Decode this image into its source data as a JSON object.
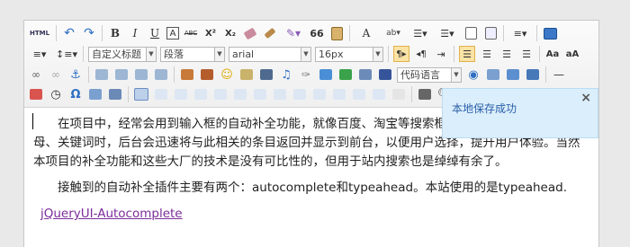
{
  "editor": {
    "toolbar": {
      "html_label": "HTML",
      "bold": "B",
      "italic": "I",
      "underline": "U",
      "fontborder": "A",
      "strikethrough": "ABC",
      "superscript": "X²",
      "subscript": "X₂",
      "blockquote": "66",
      "forecolor": "A",
      "title_select": "自定义标题",
      "paragraph_select": "段落",
      "font_select": "arial",
      "size_select": "16px",
      "code_language_select": "代码语言"
    },
    "content": {
      "paragraph1": "在项目中，经常会用到输入框的自动补全功能，就像百度、淘宝等搜索框一样，当用户输入首字母、关键词时，后台会迅速将与此相关的条目返回并显示到前台，以便用户选择，提升用户体验。当然本项目的补全功能和这些大厂的技术是没有可比性的，但用于站内搜索也是绰绰有余了。",
      "paragraph2": "接触到的自动补全插件主要有两个：autocomplete和typeahead。本站使用的是typeahead.",
      "link": "jQueryUI-Autocomplete"
    },
    "notification": {
      "message": "本地保存成功",
      "close_label": "×"
    }
  },
  "colors": {
    "toast_bg": "#dbeefb",
    "toast_text": "#2a5fa8",
    "link": "#7b2c9a",
    "active_btn": "#fbe3a5"
  }
}
